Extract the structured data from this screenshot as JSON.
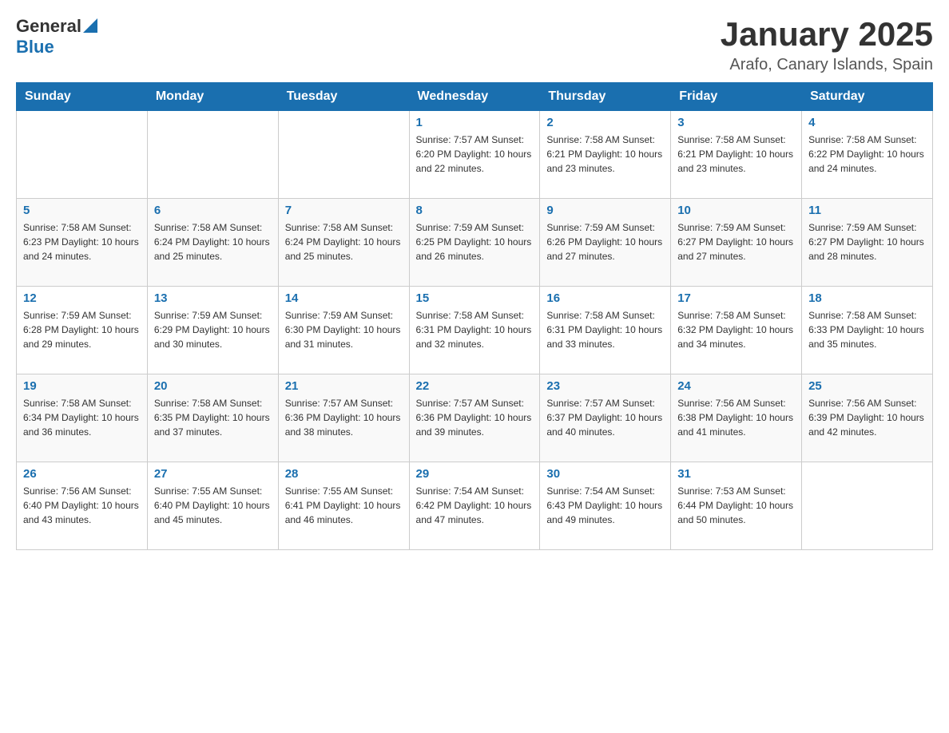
{
  "header": {
    "logo_general": "General",
    "logo_blue": "Blue",
    "month_title": "January 2025",
    "location": "Arafo, Canary Islands, Spain"
  },
  "days_of_week": [
    "Sunday",
    "Monday",
    "Tuesday",
    "Wednesday",
    "Thursday",
    "Friday",
    "Saturday"
  ],
  "weeks": [
    [
      {
        "day": "",
        "info": ""
      },
      {
        "day": "",
        "info": ""
      },
      {
        "day": "",
        "info": ""
      },
      {
        "day": "1",
        "info": "Sunrise: 7:57 AM\nSunset: 6:20 PM\nDaylight: 10 hours\nand 22 minutes."
      },
      {
        "day": "2",
        "info": "Sunrise: 7:58 AM\nSunset: 6:21 PM\nDaylight: 10 hours\nand 23 minutes."
      },
      {
        "day": "3",
        "info": "Sunrise: 7:58 AM\nSunset: 6:21 PM\nDaylight: 10 hours\nand 23 minutes."
      },
      {
        "day": "4",
        "info": "Sunrise: 7:58 AM\nSunset: 6:22 PM\nDaylight: 10 hours\nand 24 minutes."
      }
    ],
    [
      {
        "day": "5",
        "info": "Sunrise: 7:58 AM\nSunset: 6:23 PM\nDaylight: 10 hours\nand 24 minutes."
      },
      {
        "day": "6",
        "info": "Sunrise: 7:58 AM\nSunset: 6:24 PM\nDaylight: 10 hours\nand 25 minutes."
      },
      {
        "day": "7",
        "info": "Sunrise: 7:58 AM\nSunset: 6:24 PM\nDaylight: 10 hours\nand 25 minutes."
      },
      {
        "day": "8",
        "info": "Sunrise: 7:59 AM\nSunset: 6:25 PM\nDaylight: 10 hours\nand 26 minutes."
      },
      {
        "day": "9",
        "info": "Sunrise: 7:59 AM\nSunset: 6:26 PM\nDaylight: 10 hours\nand 27 minutes."
      },
      {
        "day": "10",
        "info": "Sunrise: 7:59 AM\nSunset: 6:27 PM\nDaylight: 10 hours\nand 27 minutes."
      },
      {
        "day": "11",
        "info": "Sunrise: 7:59 AM\nSunset: 6:27 PM\nDaylight: 10 hours\nand 28 minutes."
      }
    ],
    [
      {
        "day": "12",
        "info": "Sunrise: 7:59 AM\nSunset: 6:28 PM\nDaylight: 10 hours\nand 29 minutes."
      },
      {
        "day": "13",
        "info": "Sunrise: 7:59 AM\nSunset: 6:29 PM\nDaylight: 10 hours\nand 30 minutes."
      },
      {
        "day": "14",
        "info": "Sunrise: 7:59 AM\nSunset: 6:30 PM\nDaylight: 10 hours\nand 31 minutes."
      },
      {
        "day": "15",
        "info": "Sunrise: 7:58 AM\nSunset: 6:31 PM\nDaylight: 10 hours\nand 32 minutes."
      },
      {
        "day": "16",
        "info": "Sunrise: 7:58 AM\nSunset: 6:31 PM\nDaylight: 10 hours\nand 33 minutes."
      },
      {
        "day": "17",
        "info": "Sunrise: 7:58 AM\nSunset: 6:32 PM\nDaylight: 10 hours\nand 34 minutes."
      },
      {
        "day": "18",
        "info": "Sunrise: 7:58 AM\nSunset: 6:33 PM\nDaylight: 10 hours\nand 35 minutes."
      }
    ],
    [
      {
        "day": "19",
        "info": "Sunrise: 7:58 AM\nSunset: 6:34 PM\nDaylight: 10 hours\nand 36 minutes."
      },
      {
        "day": "20",
        "info": "Sunrise: 7:58 AM\nSunset: 6:35 PM\nDaylight: 10 hours\nand 37 minutes."
      },
      {
        "day": "21",
        "info": "Sunrise: 7:57 AM\nSunset: 6:36 PM\nDaylight: 10 hours\nand 38 minutes."
      },
      {
        "day": "22",
        "info": "Sunrise: 7:57 AM\nSunset: 6:36 PM\nDaylight: 10 hours\nand 39 minutes."
      },
      {
        "day": "23",
        "info": "Sunrise: 7:57 AM\nSunset: 6:37 PM\nDaylight: 10 hours\nand 40 minutes."
      },
      {
        "day": "24",
        "info": "Sunrise: 7:56 AM\nSunset: 6:38 PM\nDaylight: 10 hours\nand 41 minutes."
      },
      {
        "day": "25",
        "info": "Sunrise: 7:56 AM\nSunset: 6:39 PM\nDaylight: 10 hours\nand 42 minutes."
      }
    ],
    [
      {
        "day": "26",
        "info": "Sunrise: 7:56 AM\nSunset: 6:40 PM\nDaylight: 10 hours\nand 43 minutes."
      },
      {
        "day": "27",
        "info": "Sunrise: 7:55 AM\nSunset: 6:40 PM\nDaylight: 10 hours\nand 45 minutes."
      },
      {
        "day": "28",
        "info": "Sunrise: 7:55 AM\nSunset: 6:41 PM\nDaylight: 10 hours\nand 46 minutes."
      },
      {
        "day": "29",
        "info": "Sunrise: 7:54 AM\nSunset: 6:42 PM\nDaylight: 10 hours\nand 47 minutes."
      },
      {
        "day": "30",
        "info": "Sunrise: 7:54 AM\nSunset: 6:43 PM\nDaylight: 10 hours\nand 49 minutes."
      },
      {
        "day": "31",
        "info": "Sunrise: 7:53 AM\nSunset: 6:44 PM\nDaylight: 10 hours\nand 50 minutes."
      },
      {
        "day": "",
        "info": ""
      }
    ]
  ]
}
